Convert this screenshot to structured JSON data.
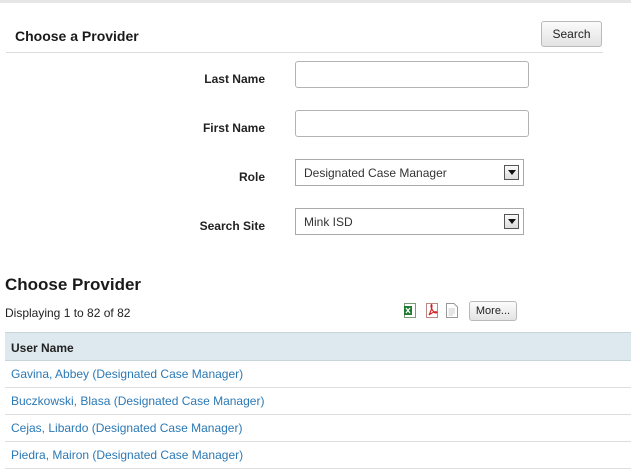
{
  "panel": {
    "title": "Choose a Provider",
    "search_button": "Search"
  },
  "form": {
    "last_name_label": "Last Name",
    "last_name_value": "",
    "first_name_label": "First Name",
    "first_name_value": "",
    "role_label": "Role",
    "role_value": "Designated Case Manager",
    "site_label": "Search Site",
    "site_value": "Mink ISD"
  },
  "results": {
    "title": "Choose Provider",
    "count_text": "Displaying 1 to 82 of 82",
    "more_button": "More...",
    "export_icons": [
      "excel-icon",
      "pdf-icon",
      "document-icon"
    ],
    "column_header": "User Name",
    "rows": [
      "Gavina, Abbey (Designated Case Manager)",
      "Buczkowski, Blasa (Designated Case Manager)",
      "Cejas, Libardo (Designated Case Manager)",
      "Piedra, Mairon (Designated Case Manager)"
    ]
  },
  "colors": {
    "link": "#2b79b5",
    "table_header_bg": "#dde9ee"
  }
}
